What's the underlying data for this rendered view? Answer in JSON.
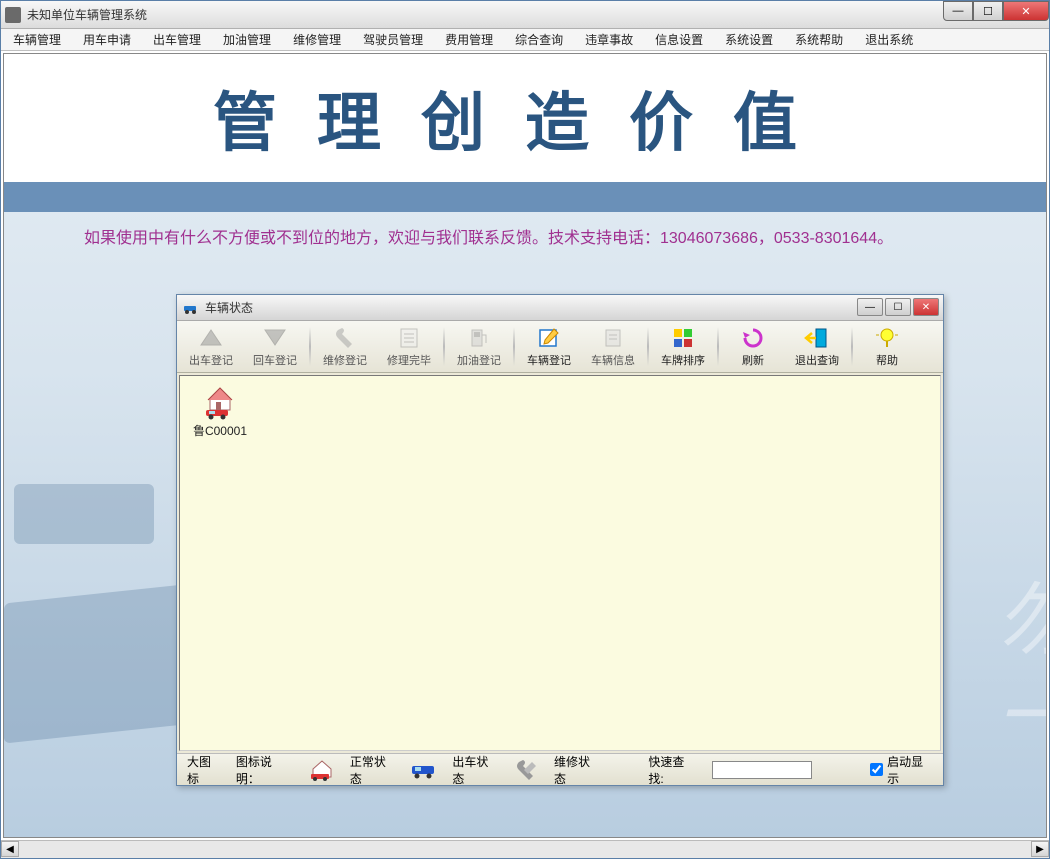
{
  "outer": {
    "title": "未知单位车辆管理系统"
  },
  "menu": {
    "items": [
      "车辆管理",
      "用车申请",
      "出车管理",
      "加油管理",
      "维修管理",
      "驾驶员管理",
      "费用管理",
      "综合查询",
      "违章事故",
      "信息设置",
      "系统设置",
      "系统帮助",
      "退出系统"
    ]
  },
  "banner": {
    "text": "管理创造价值"
  },
  "notice": {
    "text": "如果使用中有什么不方便或不到位的地方，欢迎与我们联系反馈。技术支持电话：13046073686，0533-8301644。"
  },
  "child": {
    "title": "车辆状态"
  },
  "toolbar": {
    "btns": [
      {
        "label": "出车登记",
        "enabled": false,
        "icon": "depart"
      },
      {
        "label": "回车登记",
        "enabled": false,
        "icon": "return"
      },
      {
        "label": "维修登记",
        "enabled": false,
        "icon": "repair-reg"
      },
      {
        "label": "修理完毕",
        "enabled": false,
        "icon": "repair-done"
      },
      {
        "label": "加油登记",
        "enabled": false,
        "icon": "fuel"
      },
      {
        "label": "车辆登记",
        "enabled": true,
        "icon": "vehicle-reg"
      },
      {
        "label": "车辆信息",
        "enabled": false,
        "icon": "vehicle-info"
      },
      {
        "label": "车牌排序",
        "enabled": true,
        "icon": "sort"
      },
      {
        "label": "刷新",
        "enabled": true,
        "icon": "refresh"
      },
      {
        "label": "退出查询",
        "enabled": true,
        "icon": "exit"
      },
      {
        "label": "帮助",
        "enabled": true,
        "icon": "help"
      }
    ]
  },
  "vehicles": [
    {
      "plate": "鲁C00001"
    }
  ],
  "statusbar": {
    "big_icon": "大图标",
    "legend_label": "图标说明：",
    "normal": "正常状态",
    "out": "出车状态",
    "repair": "维修状态",
    "quick_search_label": "快速查找:",
    "quick_search_value": "",
    "auto_show": "启动显示",
    "auto_show_checked": true
  }
}
